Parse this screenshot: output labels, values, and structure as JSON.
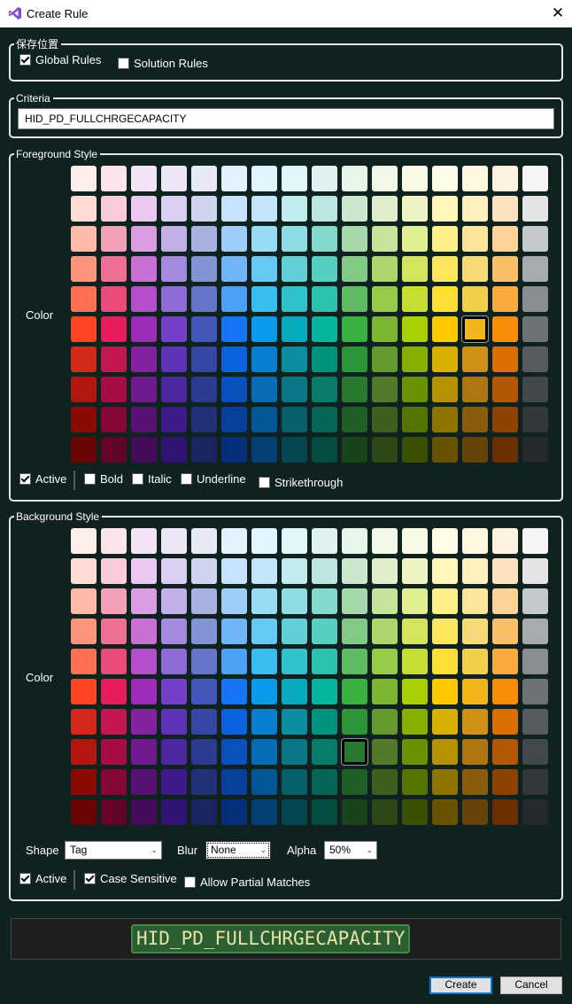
{
  "window": {
    "title": "Create Rule",
    "close_glyph": "✕"
  },
  "save_location": {
    "legend": "保存位置",
    "global_rules": {
      "label": "Global Rules",
      "checked": true
    },
    "solution_rules": {
      "label": "Solution Rules",
      "checked": false
    }
  },
  "criteria": {
    "legend": "Criteria",
    "value": "HID_PD_FULLCHRGECAPACITY"
  },
  "foreground": {
    "legend": "Foreground Style",
    "color_label": "Color",
    "selected_swatch": {
      "row": 5,
      "col": 13
    },
    "options": [
      {
        "id": "active",
        "label": "Active",
        "checked": true
      },
      {
        "id": "bold",
        "label": "Bold",
        "checked": false
      },
      {
        "id": "italic",
        "label": "Italic",
        "checked": false
      },
      {
        "id": "underline",
        "label": "Underline",
        "checked": false
      },
      {
        "id": "strikethrough",
        "label": "Strikethrough",
        "checked": false
      }
    ]
  },
  "background": {
    "legend": "Background Style",
    "color_label": "Color",
    "selected_swatch": {
      "row": 7,
      "col": 9
    },
    "shape": {
      "label": "Shape",
      "value": "Tag"
    },
    "blur": {
      "label": "Blur",
      "value": "None"
    },
    "alpha": {
      "label": "Alpha",
      "value": "50%"
    },
    "options": [
      {
        "id": "active",
        "label": "Active",
        "checked": true
      },
      {
        "id": "case-sensitive",
        "label": "Case Sensitive",
        "checked": true
      },
      {
        "id": "allow-partial",
        "label": "Allow Partial Matches",
        "checked": false
      }
    ]
  },
  "palette": [
    [
      "#fdeee9",
      "#fce4ec",
      "#f3e5f5",
      "#ede7f6",
      "#e8eaf6",
      "#e3f2fd",
      "#e1f5fe",
      "#e0f7fa",
      "#e0f2f1",
      "#e8f5e9",
      "#f1f8e9",
      "#f9fbe7",
      "#fffde7",
      "#fff8e1",
      "#fff3e0",
      "#f5f5f5"
    ],
    [
      "#ffdcd4",
      "#f8cdd9",
      "#ecc9ee",
      "#dcd0f0",
      "#cfd4ef",
      "#c7e2fb",
      "#c2e6f8",
      "#c1ecef",
      "#bde6e0",
      "#cbe7cd",
      "#dfedc8",
      "#eef4c4",
      "#fff6b9",
      "#fff0c0",
      "#fee3c0",
      "#e4e4e4"
    ],
    [
      "#ffb9a7",
      "#f4a0b6",
      "#dc9ee2",
      "#c3afe8",
      "#a8b2e0",
      "#9fcdfa",
      "#99daf5",
      "#8fdde4",
      "#84d9cd",
      "#a6d9a9",
      "#c7e299",
      "#e1ee91",
      "#fff08a",
      "#fbe59b",
      "#fdd398",
      "#c6c9cc"
    ],
    [
      "#fd957c",
      "#ee7194",
      "#c671d3",
      "#a589de",
      "#8393d3",
      "#72b4f8",
      "#66c9f3",
      "#60cfd8",
      "#55cfbf",
      "#81c985",
      "#acd56b",
      "#d2e55d",
      "#fde65f",
      "#f7da76",
      "#fbbf6a",
      "#a8abae"
    ],
    [
      "#ff7155",
      "#ea4b78",
      "#b54ec9",
      "#8e6bd6",
      "#6675c8",
      "#4aa1f5",
      "#3abcf0",
      "#31c3cc",
      "#2cc2ad",
      "#5fbc65",
      "#97ca47",
      "#c6dd34",
      "#fdde35",
      "#f3cf4e",
      "#fbab3d",
      "#8a8d90"
    ],
    [
      "#ff4423",
      "#e71d5b",
      "#9e2bb8",
      "#7440c9",
      "#4456b8",
      "#1675f5",
      "#0a9ae9",
      "#07a9bd",
      "#05b69c",
      "#3ab043",
      "#7eb631",
      "#a8cf00",
      "#fcc900",
      "#f0b61a",
      "#fb8c06",
      "#6f7275"
    ],
    [
      "#d3281c",
      "#c4164f",
      "#85229f",
      "#5f32b6",
      "#3547a3",
      "#0c61dc",
      "#0880cf",
      "#0c8ea0",
      "#00947f",
      "#2e9438",
      "#65992d",
      "#86af00",
      "#d8b000",
      "#cf9017",
      "#d96f00",
      "#575b5f"
    ],
    [
      "#b1170f",
      "#a60d46",
      "#6f1a8d",
      "#4d27a0",
      "#2c3a90",
      "#0a51bd",
      "#066db5",
      "#0a7786",
      "#077c6a",
      "#28792f",
      "#527a28",
      "#6a9200",
      "#b59200",
      "#ad760f",
      "#b25800",
      "#42474b"
    ],
    [
      "#8a0b06",
      "#850737",
      "#5a1174",
      "#3d1b8a",
      "#223078",
      "#073f9b",
      "#045796",
      "#075f6c",
      "#056655",
      "#1f5e24",
      "#3e5f1d",
      "#547300",
      "#8f7300",
      "#8a5c0b",
      "#8c4200",
      "#33373b"
    ],
    [
      "#680502",
      "#62032a",
      "#430b5a",
      "#2f1370",
      "#1a2560",
      "#04307a",
      "#033f73",
      "#05454f",
      "#034c3f",
      "#174519",
      "#2e4615",
      "#3b5000",
      "#685400",
      "#654307",
      "#692f00",
      "#25282c"
    ]
  ],
  "preview": {
    "text": "HID_PD_FULLCHRGECAPACITY"
  },
  "buttons": {
    "create": "Create",
    "cancel": "Cancel"
  }
}
